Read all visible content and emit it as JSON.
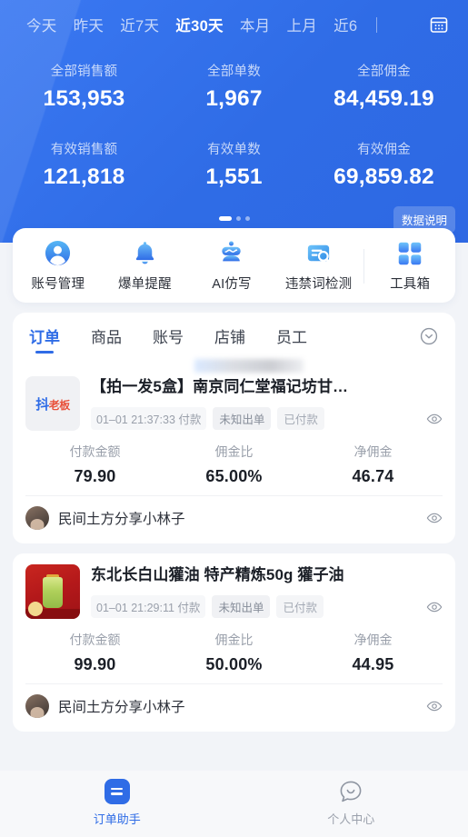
{
  "header": {
    "date_tabs": [
      {
        "label": "今天",
        "active": false
      },
      {
        "label": "昨天",
        "active": false
      },
      {
        "label": "近7天",
        "active": false
      },
      {
        "label": "近30天",
        "active": true
      },
      {
        "label": "本月",
        "active": false
      },
      {
        "label": "上月",
        "active": false
      },
      {
        "label": "近6",
        "active": false
      }
    ],
    "calendar_icon": "calendar-icon",
    "data_note_label": "数据说明",
    "carousel": {
      "total": 3,
      "active_index": 0
    },
    "stats_rows": [
      [
        {
          "label": "全部销售额",
          "value": "153,953"
        },
        {
          "label": "全部单数",
          "value": "1,967"
        },
        {
          "label": "全部佣金",
          "value": "84,459.19"
        }
      ],
      [
        {
          "label": "有效销售额",
          "value": "121,818"
        },
        {
          "label": "有效单数",
          "value": "1,551"
        },
        {
          "label": "有效佣金",
          "value": "69,859.82"
        }
      ]
    ]
  },
  "quick_actions": [
    {
      "label": "账号管理",
      "icon": "user-account-icon"
    },
    {
      "label": "爆单提醒",
      "icon": "bell-icon"
    },
    {
      "label": "AI仿写",
      "icon": "ai-robot-icon"
    },
    {
      "label": "违禁词检测",
      "icon": "text-search-icon"
    },
    {
      "label": "工具箱",
      "icon": "grid-toolbox-icon"
    }
  ],
  "content_tabs": [
    {
      "label": "订单",
      "active": true
    },
    {
      "label": "商品",
      "active": false
    },
    {
      "label": "账号",
      "active": false
    },
    {
      "label": "店铺",
      "active": false
    },
    {
      "label": "员工",
      "active": false
    }
  ],
  "tab_more_icon": "chevron-down-circle-icon",
  "order_figure_labels": {
    "amount": "付款金额",
    "rate": "佣金比",
    "net": "净佣金"
  },
  "orders": [
    {
      "thumb_type": "brand",
      "thumb_brand_main": "抖",
      "thumb_brand_sub": "老板",
      "title": "【拍一发5盒】南京同仁堂福记坊甘…",
      "time": "01–01 21:37:33 付款",
      "badge_ship": "未知出单",
      "badge_pay": "已付款",
      "amount": "79.90",
      "rate": "65.00%",
      "net": "46.74",
      "owner": "民间土方分享小林子"
    },
    {
      "thumb_type": "photo",
      "title": "东北长白山獾油 特产精炼50g 獾子油",
      "time": "01–01 21:29:11 付款",
      "badge_ship": "未知出单",
      "badge_pay": "已付款",
      "amount": "99.90",
      "rate": "50.00%",
      "net": "44.95",
      "owner": "民间土方分享小林子"
    }
  ],
  "bottom_nav": [
    {
      "label": "订单助手",
      "icon": "order-assistant-icon",
      "active": true
    },
    {
      "label": "个人中心",
      "icon": "profile-chat-icon",
      "active": false
    }
  ],
  "colors": {
    "brand_blue": "#2F6CE6",
    "hero_gradient_start": "#3A78F2",
    "hero_gradient_end": "#2E68E3",
    "page_bg": "#F2F4F8",
    "card_bg": "#FFFFFF",
    "muted_text": "#9AA0AB"
  }
}
